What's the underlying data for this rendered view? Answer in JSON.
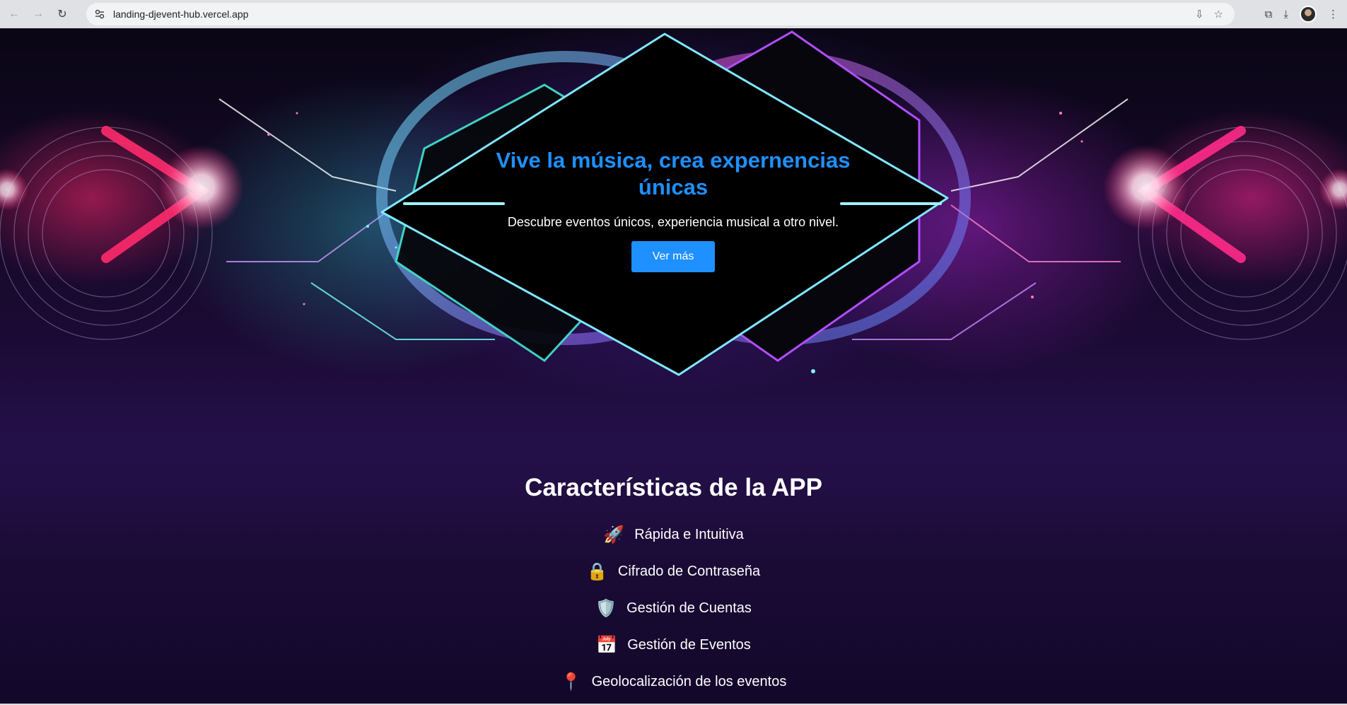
{
  "browser": {
    "url": "landing-djevent-hub.vercel.app",
    "back_icon": "←",
    "forward_icon": "→",
    "reload_icon": "↻",
    "install_icon": "⇩",
    "star_icon": "☆",
    "extensions_icon": "⧉",
    "download_icon": "⤓",
    "menu_icon": "⋮"
  },
  "hero": {
    "title": "Vive la música, crea expernencias únicas",
    "subtitle": "Descubre eventos únicos, experiencia musical a otro nivel.",
    "cta_label": "Ver más"
  },
  "features": {
    "title": "Características de la APP",
    "items": [
      {
        "icon": "🚀",
        "icon_name": "rocket-icon",
        "label": "Rápida e Intuitiva"
      },
      {
        "icon": "🔒",
        "icon_name": "lock-icon",
        "label": "Cifrado de Contraseña"
      },
      {
        "icon": "🛡️",
        "icon_name": "shield-icon",
        "label": "Gestión de Cuentas"
      },
      {
        "icon": "📅",
        "icon_name": "calendar-icon",
        "label": "Gestión de Eventos"
      },
      {
        "icon": "📍",
        "icon_name": "pin-icon",
        "label": "Geolocalización de los eventos"
      }
    ]
  },
  "colors": {
    "accent": "#1e90ff",
    "background": "#12082a"
  }
}
